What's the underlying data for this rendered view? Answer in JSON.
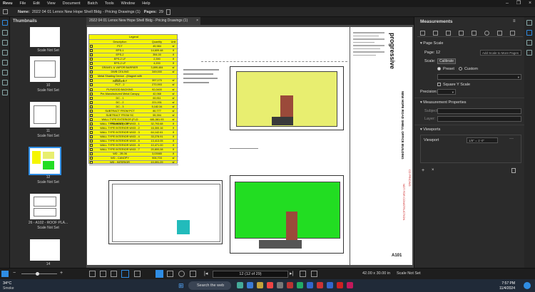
{
  "menu": {
    "logo": "Revu",
    "items": [
      "File",
      "Edit",
      "View",
      "Document",
      "Batch",
      "Tools",
      "Window",
      "Help"
    ]
  },
  "namebar": {
    "name_label": "Name:",
    "name_value": "2022 04 01 Lenox New Hope Shell Bldg - Pricing Drawings (1)",
    "pages_label": "Pages:",
    "pages_value": "29"
  },
  "thumbnails": {
    "title": "Thumbnails",
    "items": [
      {
        "num": "",
        "scale": "Scale Not Set"
      },
      {
        "num": "10",
        "scale": "Scale Not Set"
      },
      {
        "num": "11",
        "scale": "Scale Not Set"
      },
      {
        "num": "12",
        "scale": "Scale Not Set"
      },
      {
        "num": "26 - A102 - ROOF PLA...",
        "scale": "Scale Not Set"
      },
      {
        "num": "14",
        "scale": ""
      }
    ]
  },
  "doc_tab": {
    "title": "2022 04 01 Lenox New Hope Shell Bldg - Pricing Drawings (1)"
  },
  "legend": {
    "title": "Legend",
    "headers": [
      "Description",
      "Quantity",
      "Unit"
    ],
    "rows": [
      {
        "d": "PCT",
        "q": "49,984",
        "u": "sf"
      },
      {
        "d": "EPS-1",
        "q": "14,609.48",
        "u": "lf"
      },
      {
        "d": "EPS-2",
        "q": "394,00",
        "u": "lf"
      },
      {
        "d": "EPS-2 LF",
        "q": "2,390",
        "u": "lf"
      },
      {
        "d": "EPS-2 LF",
        "q": "4,200",
        "u": "lf"
      },
      {
        "d": "GRAVEL & VAPOR BARRIER",
        "q": "3,899,484",
        "u": "sf"
      },
      {
        "d": "DWB CEILING",
        "q": "349,000",
        "u": "sf"
      },
      {
        "d": "Metal Shading Device - (Magnet with Waveform F",
        "q": "",
        "u": ""
      },
      {
        "d": "PCT - 1",
        "q": "397,170",
        "u": "sf"
      },
      {
        "d": "PCT - 2",
        "q": "270,993",
        "u": "sf"
      },
      {
        "d": "PLYWOOD BACKING",
        "q": "92,0400",
        "u": "sf"
      },
      {
        "d": "Pre-Manufactured Metal Canopy",
        "q": "42,068",
        "u": "sf"
      },
      {
        "d": "DC - 1",
        "q": "60,911",
        "u": "sf"
      },
      {
        "d": "DC - 2",
        "q": "221,931",
        "u": "sf"
      },
      {
        "d": "DC - 3",
        "q": "5,182.34",
        "u": "sf"
      },
      {
        "d": "SUBTRACT FROM PCT",
        "q": "80,777",
        "u": "sf"
      },
      {
        "d": "SUBTRACT FROM SC",
        "q": "59,394",
        "u": "sf"
      },
      {
        "d": "WALL TYPE EXTERIOR (FLD FRAMING) - EF",
        "q": "681,581.93",
        "u": "sf"
      },
      {
        "d": "WALL TYPE INTERIOR W/03 - 1",
        "q": "32,793.68",
        "u": "lf"
      },
      {
        "d": "WALL TYPE INTERIOR W/03 - 2",
        "q": "16,300.16",
        "u": "lf"
      },
      {
        "d": "WALL TYPE INTERIOR W/03 - 3",
        "q": "64,142.61",
        "u": "lf"
      },
      {
        "d": "WALL TYPE INTERIOR W/03 - 4",
        "q": "33,278.91",
        "u": "lf"
      },
      {
        "d": "WALL TYPE INTERIOR W/03 - 5",
        "q": "13,413.05",
        "u": "lf"
      },
      {
        "d": "WALL TYPE INTERIOR W/03 - 6",
        "q": "10,471.00",
        "u": "lf"
      },
      {
        "d": "WALL TYPE INTERIOR W/03 - 7",
        "q": "20,800,08",
        "u": "lf"
      },
      {
        "d": "WD - 2B.06",
        "q": "3,03985",
        "u": "lf"
      },
      {
        "d": "WD - CANOPY",
        "q": "906,703",
        "u": "sf"
      },
      {
        "d": "WD - INTERIOR",
        "q": "10,091.29",
        "u": "sf"
      }
    ]
  },
  "titleblock": {
    "firm": "progressive",
    "project": "NEW HOPE ROAD SHELL OFFICE BUILDING",
    "status1": "CD PRICING",
    "status2": "NOT FOR CONSTRUCTION",
    "sheet": "A101"
  },
  "measurements": {
    "title": "Measurements",
    "page_scale": "Page Scale",
    "page_label": "Page:",
    "page_value": "12",
    "add_scale_placeholder": "Add Scale to More Pages",
    "scale_label": "Scale:",
    "calibrate": "Calibrate",
    "preset": "Preset",
    "custom": "Custom",
    "square_y": "Square Y Scale",
    "precision_label": "Precision:",
    "props_title": "Measurement Properties",
    "subject_label": "Subject:",
    "layer_label": "Layer:",
    "viewports_title": "Viewports",
    "viewport_label": "Viewport",
    "viewport_value": "1/8\" = 1'-0\""
  },
  "status": {
    "page_nav": "12 (12 of 29)",
    "size": "42.00 x 30.00 in",
    "scale": "Scale Not Set"
  },
  "taskbar": {
    "weather_temp": "34°C",
    "weather_desc": "Smoke",
    "search": "Search the web",
    "time": "7:57 PM",
    "date": "11/4/2024"
  },
  "colors": {
    "accent": "#2f8de4",
    "legend_yellow": "#f5f500",
    "plan_green": "#22dd22",
    "plan_yellow": "#e8ee70"
  }
}
